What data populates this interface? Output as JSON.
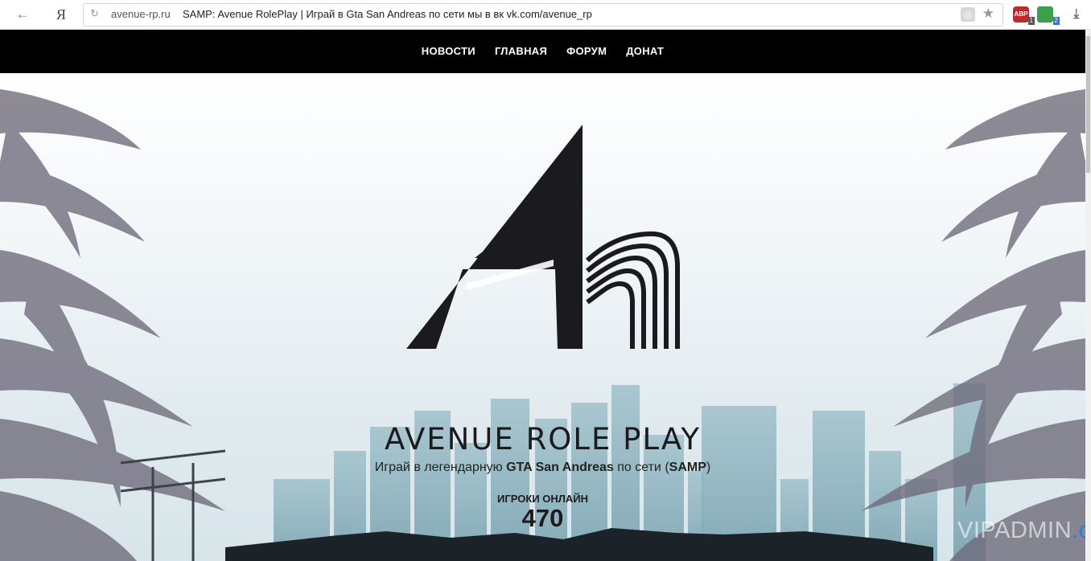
{
  "browser": {
    "url": "avenue-rp.ru",
    "title": "SAMP: Avenue RolePlay | Играй в Gta San Andreas по сети мы в вк vk.com/avenue_rp",
    "yandex_label": "Я",
    "adblock_label": "ABP",
    "adblock_count": "1",
    "save_count": "2"
  },
  "nav": {
    "items": [
      "НОВОСТИ",
      "ГЛАВНАЯ",
      "ФОРУМ",
      "ДОНАТ"
    ]
  },
  "hero": {
    "title": "AVENUE ROLE PLAY",
    "subtitle_pre": "Играй в легендарную ",
    "subtitle_game": "GTA San Andreas",
    "subtitle_mid": " по сети (",
    "subtitle_samp": "SAMP",
    "subtitle_post": ")",
    "online_label": "ИГРОКИ ОНЛАЙН",
    "online_count": "470"
  },
  "watermark": {
    "main": "VIPADMIN",
    "domain": ".club"
  },
  "colors": {
    "nav_bg": "#000000",
    "logo": "#1b1b1f",
    "skyline": "#8fb3bf",
    "palm": "#6e6a7a",
    "watermark_domain": "#2f7bd8"
  }
}
